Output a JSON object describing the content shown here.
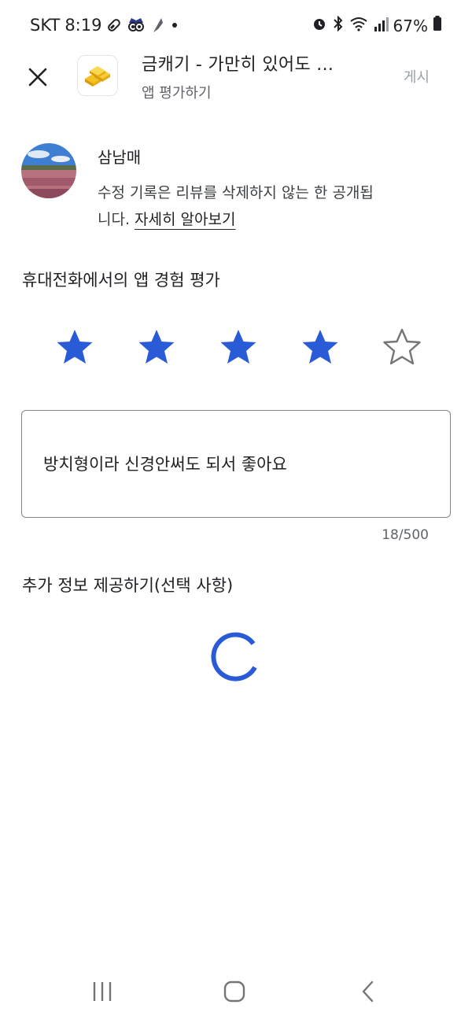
{
  "status_bar": {
    "carrier": "SKT",
    "time": "8:19",
    "battery": "67%"
  },
  "header": {
    "app_title": "금캐기 - 가만히 있어도 ...",
    "subtitle": "앱 평가하기",
    "post_label": "게시"
  },
  "user": {
    "name": "삼남매",
    "notice": "수정 기록은 리뷰를 삭제하지 않는 한 공개됩니다.",
    "learn_more": "자세히 알아보기"
  },
  "rating": {
    "heading": "휴대전화에서의 앱 경험 평가",
    "value": 4,
    "max": 5,
    "filled_color": "#2a5bd7",
    "empty_color": "#757575"
  },
  "review": {
    "text": "방치형이라 신경안써도 되서 좋아요",
    "char_count": "18/500"
  },
  "extra": {
    "heading": "추가 정보 제공하기(선택 사항)"
  },
  "colors": {
    "accent": "#2a5bd7",
    "muted": "#9aa0a6"
  }
}
